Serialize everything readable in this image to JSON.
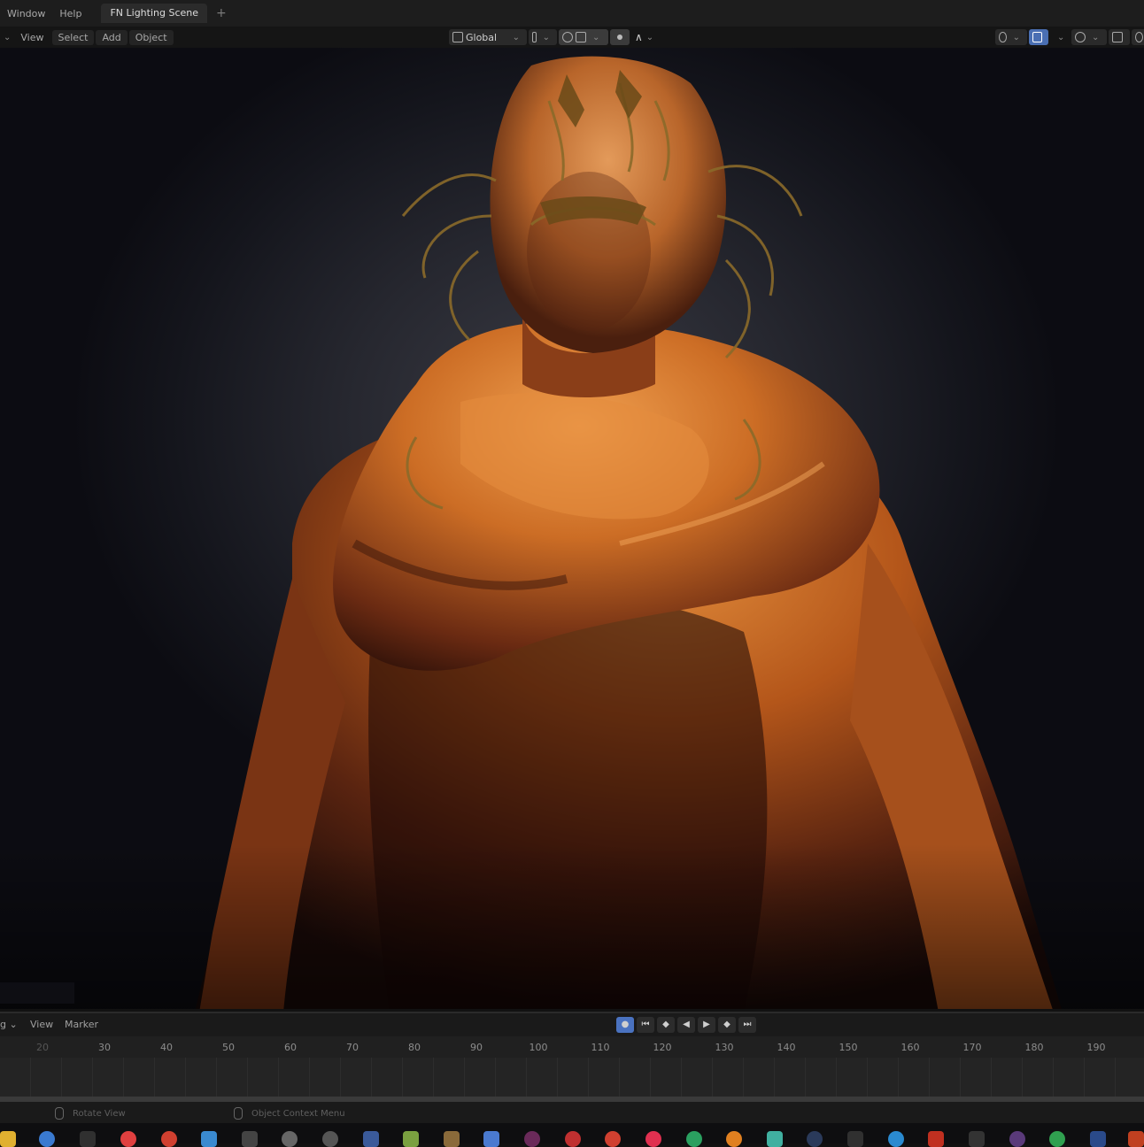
{
  "topbar": {
    "menus": [
      "Window",
      "Help"
    ],
    "active_tab": "FN Lighting Scene",
    "add_tab": "+"
  },
  "viewport_header": {
    "menus": [
      "View",
      "Select",
      "Add",
      "Object"
    ],
    "transform_orientation": "Global"
  },
  "timeline": {
    "menus": [
      "View",
      "Marker"
    ],
    "frame_ticks": [
      "20",
      "30",
      "40",
      "50",
      "60",
      "70",
      "80",
      "90",
      "100",
      "110",
      "120",
      "130",
      "140",
      "150",
      "160",
      "170",
      "180",
      "190"
    ]
  },
  "statusbar": {
    "hint_left": "Rotate View",
    "hint_right": "Object Context Menu"
  },
  "colors": {
    "accent": "#4a72c0",
    "sculpt_orange": "#c8661f",
    "gold": "#8a6a2a"
  },
  "taskbar_icons": [
    "file-explorer-icon",
    "wordpress-icon",
    "app-icon",
    "chrome-icon",
    "capture-icon",
    "grid-icon",
    "settings-icon",
    "obs-icon",
    "keyboard-icon",
    "android-icon",
    "folder-icon",
    "calculator-icon",
    "davinci-icon",
    "security-icon",
    "app-icon-2",
    "record-icon",
    "upwork-icon",
    "blender-icon",
    "marmoset-icon",
    "steam-icon",
    "epic-icon",
    "discord-icon",
    "app-icon-3",
    "app-icon-4",
    "sphere-icon",
    "app-icon-5",
    "app-icon-6",
    "app-icon-7"
  ]
}
